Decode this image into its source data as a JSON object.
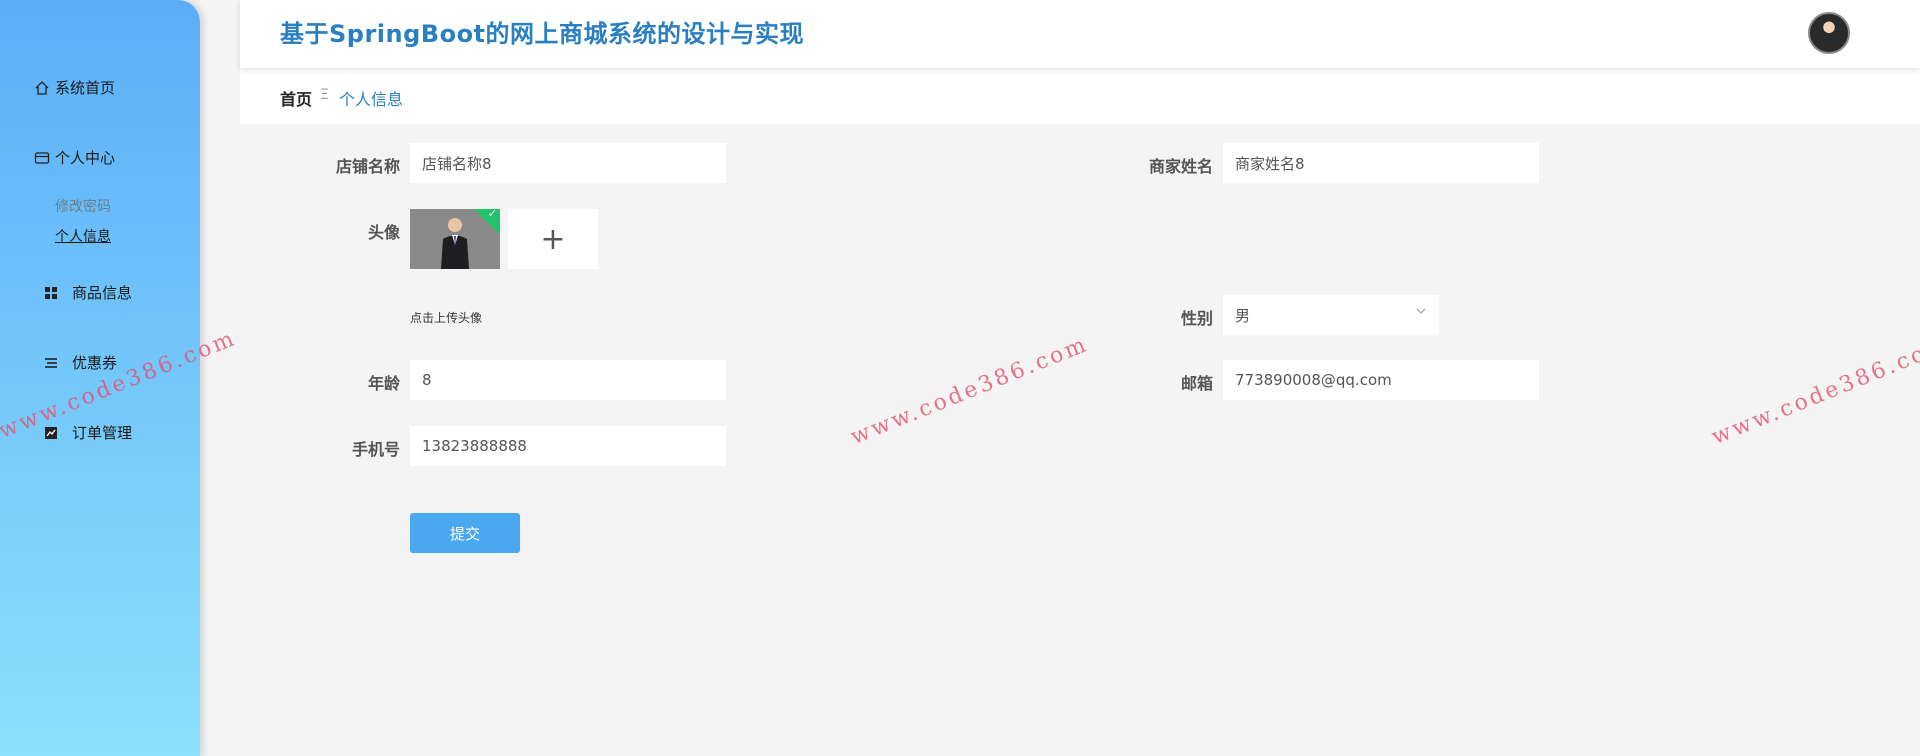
{
  "app": {
    "title": "基于SpringBoot的网上商城系统的设计与实现"
  },
  "sidebar": {
    "items": [
      {
        "label": "系统首页",
        "icon": "home-icon"
      },
      {
        "label": "个人中心",
        "icon": "card-icon"
      },
      {
        "label": "商品信息",
        "icon": "grid-icon"
      },
      {
        "label": "优惠券",
        "icon": "list-icon"
      },
      {
        "label": "订单管理",
        "icon": "chart-icon"
      }
    ],
    "submenu": [
      {
        "label": "修改密码",
        "active": false
      },
      {
        "label": "个人信息",
        "active": true
      }
    ]
  },
  "breadcrumb": {
    "home": "首页",
    "separator": "Ξ",
    "current": "个人信息"
  },
  "form": {
    "shop_name": {
      "label": "店铺名称",
      "value": "店铺名称8"
    },
    "merchant_name": {
      "label": "商家姓名",
      "value": "商家姓名8"
    },
    "avatar": {
      "label": "头像",
      "hint": "点击上传头像",
      "add": "+"
    },
    "gender": {
      "label": "性别",
      "value": "男"
    },
    "age": {
      "label": "年龄",
      "value": "8"
    },
    "email": {
      "label": "邮箱",
      "value": "773890008@qq.com"
    },
    "phone": {
      "label": "手机号",
      "value": "13823888888"
    },
    "submit_label": "提交"
  },
  "watermark": {
    "text": "www.code386.com"
  },
  "colors": {
    "accent": "#2a7fc1",
    "sidebar_top": "#5aaef8",
    "sidebar_bottom": "#8de0fb",
    "button": "#4aa8f0",
    "success": "#22c36a"
  }
}
